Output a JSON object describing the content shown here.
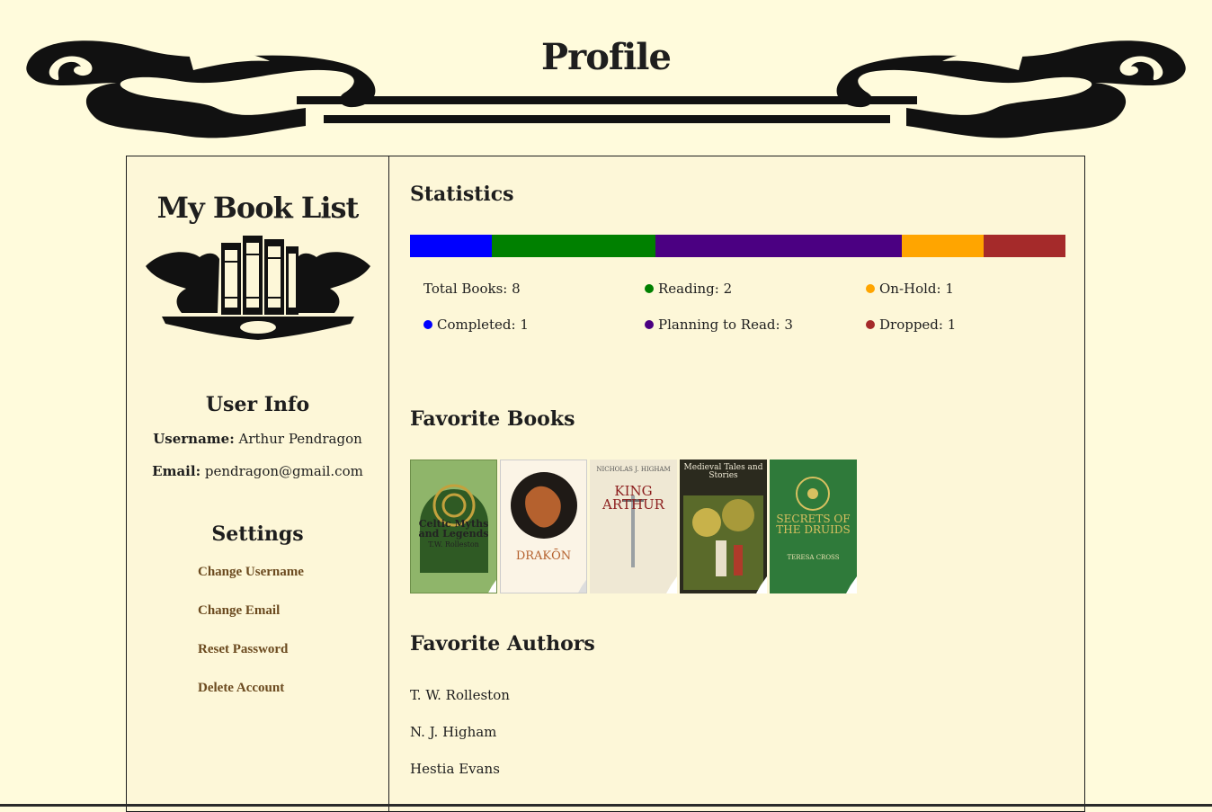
{
  "page": {
    "title": "Profile"
  },
  "sidebar": {
    "brand": "My Book List",
    "user_info": {
      "title": "User Info",
      "username_label": "Username:",
      "username": "Arthur Pendragon",
      "email_label": "Email:",
      "email": "pendragon@gmail.com"
    },
    "settings": {
      "title": "Settings",
      "links": [
        "Change Username",
        "Change Email",
        "Reset Password",
        "Delete Account"
      ]
    }
  },
  "statistics": {
    "title": "Statistics",
    "total_label": "Total Books: 8",
    "items": [
      {
        "label": "Reading: 2",
        "color": "#008000"
      },
      {
        "label": "On-Hold: 1",
        "color": "#ffa500"
      },
      {
        "label": "Completed: 1",
        "color": "#0000ff"
      },
      {
        "label": "Planning to Read: 3",
        "color": "#4b0082"
      },
      {
        "label": "Dropped: 1",
        "color": "#a52a2a"
      }
    ],
    "bar": [
      {
        "count": 1,
        "color": "#0000ff"
      },
      {
        "count": 2,
        "color": "#008000"
      },
      {
        "count": 3,
        "color": "#4b0082"
      },
      {
        "count": 1,
        "color": "#ffa500"
      },
      {
        "count": 1,
        "color": "#a52a2a"
      }
    ]
  },
  "favorite_books": {
    "title": "Favorite Books",
    "covers": [
      {
        "title": "Celtic Myths and Legends",
        "author": "T.W. Rolleston",
        "bg": "#8fb56a"
      },
      {
        "title": "DRAKŌN",
        "author": "",
        "bg": "#fbf4e6"
      },
      {
        "title": "KING ARTHUR",
        "author": "NICHOLAS J. HIGHAM",
        "bg": "#efe8d4"
      },
      {
        "title": "Medieval Tales and Stories",
        "author": "",
        "bg": "#2b2a1e"
      },
      {
        "title": "SECRETS OF THE DRUIDS",
        "author": "TERESA CROSS",
        "bg": "#2f7a3a"
      }
    ]
  },
  "favorite_authors": {
    "title": "Favorite Authors",
    "items": [
      "T. W. Rolleston",
      "N. J. Higham",
      "Hestia Evans"
    ]
  }
}
